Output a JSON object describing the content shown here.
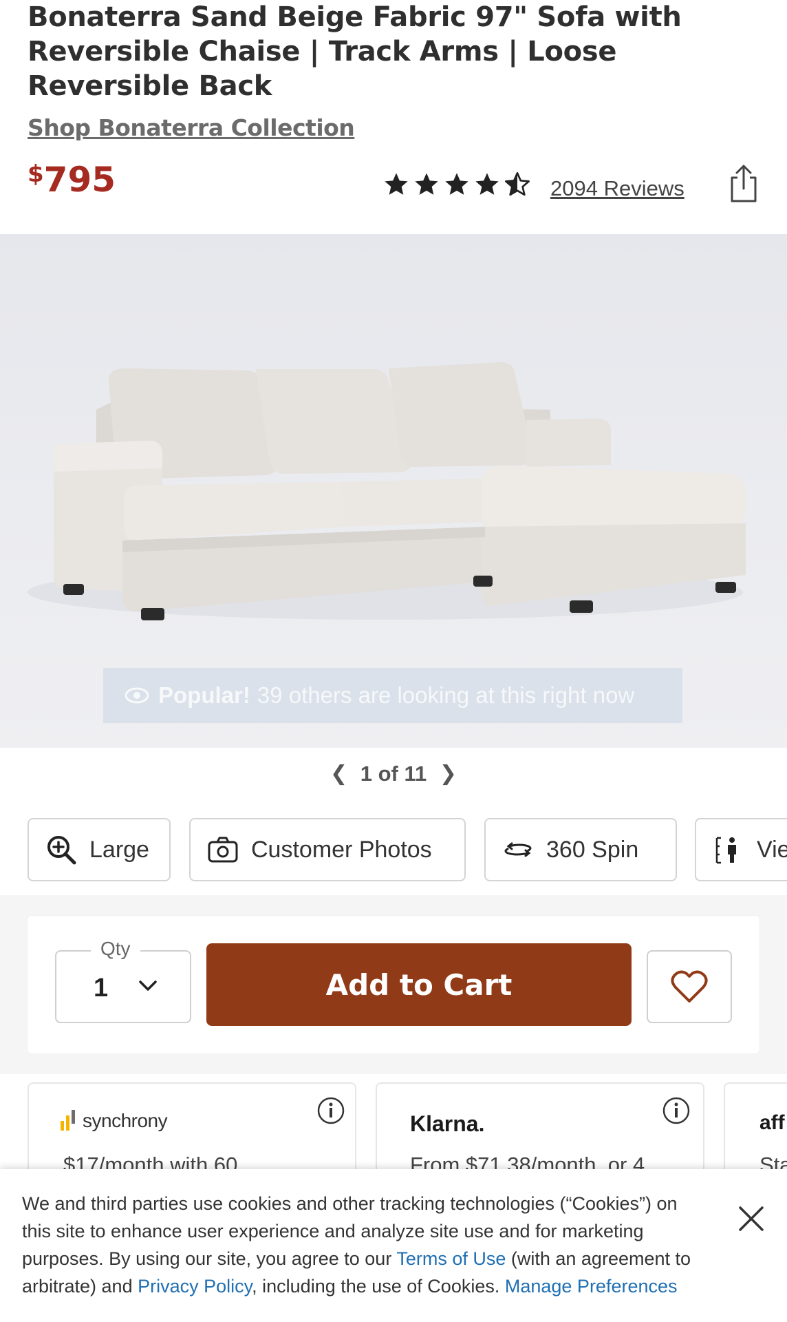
{
  "product": {
    "title": "Bonaterra Sand Beige Fabric 97\" Sofa with Reversible Chaise | Track Arms | Loose Reversible Back",
    "collection_link": "Shop Bonaterra Collection",
    "price_currency": "$",
    "price_amount": "795",
    "rating": 4.5,
    "rating_max": 5,
    "reviews_label": "2094 Reviews"
  },
  "gallery": {
    "popular_label": "Popular!",
    "popular_text": "39 others are looking at this right now",
    "pager_current": "1",
    "pager_of": "of",
    "pager_total": "11",
    "pager_text": "1 of 11"
  },
  "view_buttons": {
    "large": "Large",
    "customer_photos": "Customer Photos",
    "spin": "360 Spin",
    "view_in_room": "Vie"
  },
  "cart": {
    "qty_label": "Qty",
    "qty_value": "1",
    "add_to_cart": "Add to Cart"
  },
  "financing": {
    "synchrony_brand": "synchrony",
    "synchrony_text": "$17/month with 60",
    "klarna_brand": "Klarna.",
    "klarna_text": "From $71.38/month, or 4",
    "affirm_brand": "aff",
    "affirm_text": "Sta"
  },
  "cookie_banner": {
    "text_1": "We and third parties use cookies and other tracking technologies (“Cookies”) on this site to enhance user experience and analyze site use and for marketing purposes. By using our site, you agree to our ",
    "terms_link": "Terms of Use",
    "text_2": " (with an agreement to arbitrate) and ",
    "privacy_link": "Privacy Policy",
    "text_3": ", including the use of Cookies. ",
    "manage_link": "Manage Preferences"
  },
  "colors": {
    "price": "#a52a1f",
    "add_to_cart_bg": "#913a17",
    "link_blue": "#1f6fb2"
  },
  "icons": [
    "star-icon",
    "star-half-icon",
    "share-icon",
    "eye-icon",
    "zoom-in-icon",
    "camera-icon",
    "spin-360-icon",
    "view-in-room-icon",
    "chevron-down-icon",
    "heart-icon",
    "info-icon",
    "close-icon"
  ]
}
